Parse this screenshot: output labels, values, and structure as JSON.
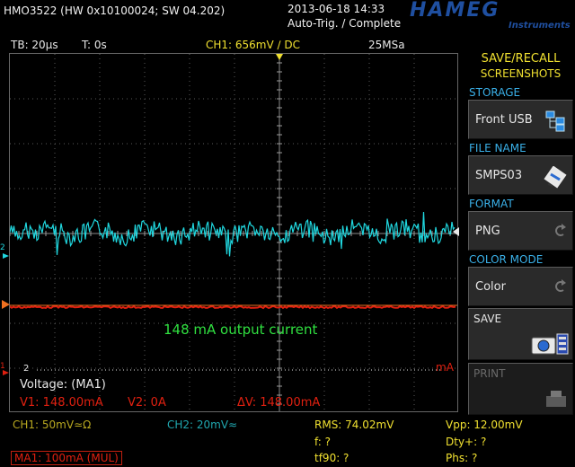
{
  "header": {
    "device": "HMO3522 (HW 0x10100024; SW 04.202)",
    "datetime": "2013-06-18 14:33",
    "trigger_status": "Auto-Trig. / Complete",
    "brand": "HAMEG",
    "brand_sub": "Instruments"
  },
  "info_bar": {
    "timebase": "TB: 20µs",
    "trigger_time": "T: 0s",
    "ch1_trigger": "CH1: 656mV ∕ DC",
    "sample_rate": "25MSa"
  },
  "screen": {
    "annotation": "148 mA output current",
    "measure_title": "Voltage: (MA1)",
    "v1": "V1: 148.00mA",
    "v2": "V2: 0A",
    "dv": "ΔV: 148.00mA",
    "unit_marker": "mA",
    "marker_2": "2"
  },
  "panel": {
    "title_line1": "SAVE/RECALL",
    "title_line2": "SCREENSHOTS",
    "storage_label": "STORAGE",
    "storage_value": "Front USB",
    "filename_label": "FILE NAME",
    "filename_value": "SMPS03",
    "format_label": "FORMAT",
    "format_value": "PNG",
    "colormode_label": "COLOR MODE",
    "colormode_value": "Color",
    "save_label": "SAVE",
    "print_label": "PRINT"
  },
  "bottom": {
    "ch1": "CH1: 50mV≃Ω",
    "ch2": "CH2: 20mV≈",
    "ma1": "MA1: 100mA (MUL)",
    "rms": "RMS: 74.02mV",
    "freq": "f: ?",
    "tf90": "tf90: ?",
    "vpp": "Vpp: 12.00mV",
    "dty": "Dty+: ?",
    "phs": "Phs: ?"
  },
  "colors": {
    "ch1_yellow": "#f0e030",
    "ch2_cyan": "#20d8e0",
    "math_red": "#e02010",
    "annotation_green": "#30e040",
    "label_blue": "#3ab0e8"
  }
}
